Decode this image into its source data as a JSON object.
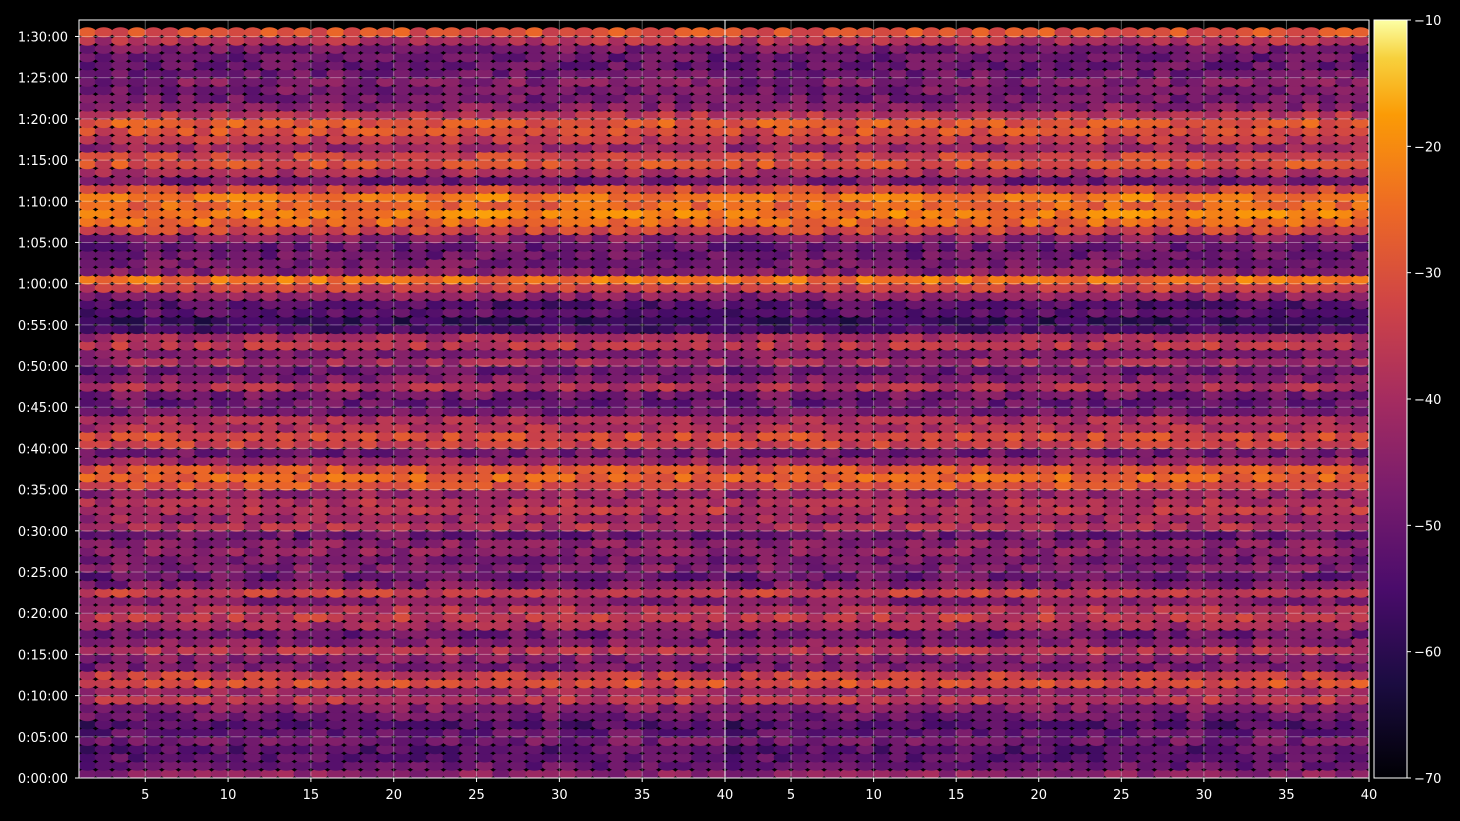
{
  "chart_data": [
    {
      "type": "heatmap",
      "panel": "left",
      "title": "",
      "xlabel": "",
      "ylabel": "",
      "xlim": [
        1,
        40
      ],
      "ylim": [
        "0:00:00",
        "1:32:00"
      ],
      "x_ticks": [
        "5",
        "10",
        "15",
        "20",
        "25",
        "30",
        "35",
        "40"
      ],
      "y_ticks": [
        "0:00:00",
        "0:05:00",
        "0:10:00",
        "0:15:00",
        "0:20:00",
        "0:25:00",
        "0:30:00",
        "0:35:00",
        "0:40:00",
        "0:45:00",
        "0:50:00",
        "0:55:00",
        "1:00:00",
        "1:05:00",
        "1:10:00",
        "1:15:00",
        "1:20:00",
        "1:25:00",
        "1:30:00"
      ],
      "grid": true,
      "colormap": "inferno",
      "description_scale": [
        -70,
        -10
      ],
      "time_profile": {
        "time_minutes": [
          0,
          1,
          2,
          3,
          4,
          5,
          6,
          7,
          8,
          9,
          10,
          11,
          12,
          13,
          14,
          15,
          16,
          17,
          18,
          19,
          20,
          21,
          22,
          23,
          24,
          25,
          26,
          27,
          28,
          29,
          30,
          31,
          32,
          33,
          34,
          35,
          36,
          37,
          38,
          39,
          40,
          41,
          42,
          43,
          44,
          45,
          46,
          47,
          48,
          49,
          50,
          51,
          52,
          53,
          54,
          55,
          56,
          57,
          58,
          59,
          60,
          61,
          62,
          63,
          64,
          65,
          66,
          67,
          68,
          69,
          70,
          71,
          72,
          73,
          74,
          75,
          76,
          77,
          78,
          79,
          80,
          81,
          82,
          83,
          84,
          85,
          86,
          87,
          88,
          89,
          90
        ],
        "values": [
          -44,
          -50,
          -52,
          -53,
          -48,
          -51,
          -54,
          -49,
          -45,
          -36,
          -42,
          -30,
          -34,
          -48,
          -45,
          -37,
          -45,
          -50,
          -41,
          -35,
          -38,
          -46,
          -34,
          -47,
          -50,
          -46,
          -48,
          -44,
          -45,
          -50,
          -38,
          -42,
          -36,
          -38,
          -43,
          -29,
          -26,
          -30,
          -42,
          -49,
          -33,
          -31,
          -38,
          -39,
          -49,
          -50,
          -48,
          -38,
          -46,
          -50,
          -41,
          -46,
          -36,
          -40,
          -55,
          -59,
          -52,
          -54,
          -45,
          -34,
          -24,
          -46,
          -48,
          -50,
          -50,
          -45,
          -33,
          -25,
          -22,
          -26,
          -22,
          -33,
          -49,
          -39,
          -30,
          -33,
          -42,
          -36,
          -30,
          -28,
          -37,
          -45,
          -48,
          -48,
          -46,
          -49,
          -50,
          -50,
          -47,
          -38,
          -30
        ]
      }
    },
    {
      "type": "heatmap",
      "panel": "right",
      "title": "",
      "xlabel": "",
      "ylabel": "",
      "xlim": [
        1,
        40
      ],
      "ylim": [
        "0:00:00",
        "1:32:00"
      ],
      "x_ticks": [
        "5",
        "10",
        "15",
        "20",
        "25",
        "30",
        "35",
        "40"
      ],
      "y_ticks": [],
      "grid": true,
      "colormap": "inferno",
      "description_scale": [
        -70,
        -10
      ],
      "time_profile": {
        "time_minutes": [
          0,
          1,
          2,
          3,
          4,
          5,
          6,
          7,
          8,
          9,
          10,
          11,
          12,
          13,
          14,
          15,
          16,
          17,
          18,
          19,
          20,
          21,
          22,
          23,
          24,
          25,
          26,
          27,
          28,
          29,
          30,
          31,
          32,
          33,
          34,
          35,
          36,
          37,
          38,
          39,
          40,
          41,
          42,
          43,
          44,
          45,
          46,
          47,
          48,
          49,
          50,
          51,
          52,
          53,
          54,
          55,
          56,
          57,
          58,
          59,
          60,
          61,
          62,
          63,
          64,
          65,
          66,
          67,
          68,
          69,
          70,
          71,
          72,
          73,
          74,
          75,
          76,
          77,
          78,
          79,
          80,
          81,
          82,
          83,
          84,
          85,
          86,
          87,
          88,
          89,
          90
        ],
        "values": [
          -44,
          -50,
          -52,
          -53,
          -48,
          -51,
          -54,
          -49,
          -45,
          -36,
          -42,
          -30,
          -34,
          -48,
          -45,
          -37,
          -45,
          -50,
          -41,
          -35,
          -38,
          -46,
          -34,
          -47,
          -50,
          -46,
          -48,
          -44,
          -45,
          -50,
          -38,
          -42,
          -36,
          -38,
          -43,
          -29,
          -26,
          -30,
          -42,
          -49,
          -33,
          -31,
          -38,
          -39,
          -49,
          -50,
          -48,
          -38,
          -46,
          -50,
          -41,
          -46,
          -36,
          -40,
          -55,
          -59,
          -52,
          -54,
          -45,
          -34,
          -24,
          -46,
          -48,
          -50,
          -50,
          -45,
          -33,
          -25,
          -22,
          -26,
          -22,
          -33,
          -49,
          -39,
          -30,
          -33,
          -42,
          -36,
          -30,
          -28,
          -37,
          -45,
          -48,
          -48,
          -46,
          -49,
          -50,
          -50,
          -47,
          -38,
          -30
        ]
      }
    }
  ],
  "colorbar": {
    "ticks": [
      "−10",
      "−20",
      "−30",
      "−40",
      "−50",
      "−60",
      "−70"
    ],
    "min": -70,
    "max": -10
  },
  "colors": {
    "background": "#000000",
    "axis": "#ffffff",
    "grid": "#ffffff"
  }
}
